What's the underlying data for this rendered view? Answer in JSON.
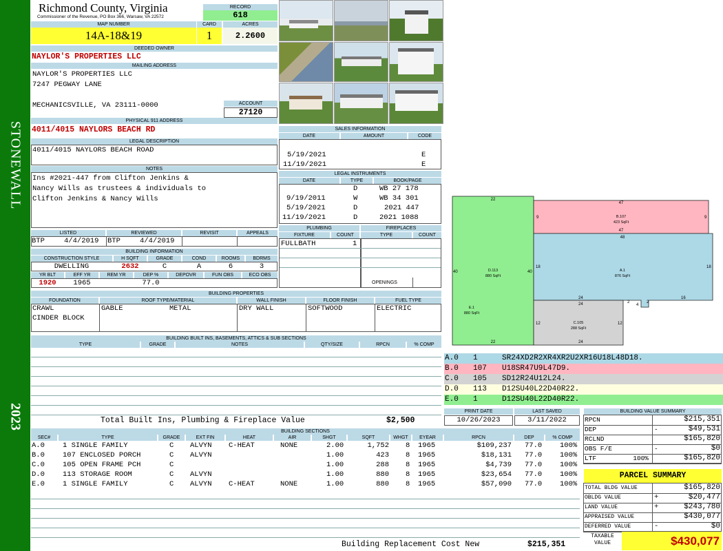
{
  "side": {
    "label": "STONEWALL",
    "year": "2023"
  },
  "header": {
    "county": "Richmond County, Virginia",
    "commissioner": "Commissioner of the Revenue, PO Box 366, Warsaw, VA 22572",
    "record_label": "RECORD",
    "record": "618",
    "map_label": "MAP NUMBER",
    "map": "14A-18&19",
    "card_label": "CARD",
    "card": "1",
    "acres_label": "ACRES",
    "acres": "2.2600"
  },
  "owner": {
    "label": "DEEDED OWNER",
    "name": "NAYLOR'S PROPERTIES LLC",
    "mail_label": "MAILING ADDRESS",
    "mail1": "NAYLOR'S PROPERTIES LLC",
    "mail2": "7247 PEGWAY LANE",
    "mail3": "MECHANICSVILLE, VA 23111-0000",
    "account_label": "ACCOUNT",
    "account": "27120",
    "phys_label": "PHYSICAL 911 ADDRESS",
    "phys": "4011/4015 NAYLORS BEACH RD",
    "legal_label": "LEGAL DESCRIPTION",
    "legal": "4011/4015 NAYLORS BEACH ROAD",
    "notes_label": "NOTES",
    "notes": [
      "Ins #2021-447 from Clifton Jenkins &",
      "Nancy Wills as trustees & individuals to",
      "Clifton Jenkins & Nancy Wills"
    ]
  },
  "review": {
    "listed_label": "LISTED",
    "reviewed_label": "REVIEWED",
    "revisit_label": "REVISIT",
    "appeals_label": "APPEALS",
    "listed_by": "BTP",
    "listed": "4/4/2019",
    "reviewed_by": "BTP",
    "reviewed": "4/4/2019"
  },
  "bldg_info": {
    "label": "BUILDING INFORMATION",
    "h": [
      "CONSTRUCTION STYLE",
      "H SQFT",
      "GRADE",
      "COND",
      "ROOMS",
      "BDRMS"
    ],
    "v": [
      "DWELLING",
      "2632",
      "C",
      "A",
      "6",
      "3"
    ],
    "h2": [
      "YR BLT",
      "EFF YR",
      "REM YR",
      "DEP %",
      "DEPOVR",
      "FUN OBS",
      "ECO OBS"
    ],
    "v2": [
      "1920",
      "1965",
      "",
      "77.0",
      "",
      "",
      ""
    ]
  },
  "props": {
    "label": "BUILDING PROPERTIES",
    "h": [
      "FOUNDATION",
      "ROOF TYPE/MATERIAL",
      "WALL FINISH",
      "FLOOR FINISH",
      "FUEL TYPE"
    ],
    "foundation": [
      "CRAWL",
      "CINDER BLOCK"
    ],
    "roof1": "GABLE",
    "roof2": "METAL",
    "wall": "DRY WALL",
    "floor": "SOFTWOOD",
    "fuel": "ELECTRIC"
  },
  "builtins": {
    "label": "BUILDING BUILT INS, BASEMENTS, ATTICS & SUB SECTIONS",
    "h": [
      "TYPE",
      "GRADE",
      "NOTES",
      "QTY/SIZE",
      "RPCN",
      "% COMP"
    ],
    "total_label": "Total Built Ins, Plumbing & Fireplace Value",
    "total": "$2,500"
  },
  "sales": {
    "label": "SALES INFORMATION",
    "h": [
      "DATE",
      "AMOUNT",
      "CODE"
    ],
    "rows": [
      [
        "5/19/2021",
        "",
        "E"
      ],
      [
        "11/19/2021",
        "",
        "E"
      ]
    ]
  },
  "instruments": {
    "label": "LEGAL INSTRUMENTS",
    "h": [
      "DATE",
      "TYPE",
      "BOOK/PAGE"
    ],
    "rows": [
      [
        "",
        "D",
        "WB 27 178"
      ],
      [
        "9/19/2011",
        "W",
        "WB 34 301"
      ],
      [
        "5/19/2021",
        "D",
        "2021 447"
      ],
      [
        "11/19/2021",
        "D",
        "2021 1088"
      ]
    ]
  },
  "plumbing": {
    "label": "PLUMBING",
    "h": [
      "FIXTURE",
      "COUNT"
    ],
    "rows": [
      [
        "FULLBATH",
        "1"
      ]
    ]
  },
  "fireplaces": {
    "label": "FIREPLACES",
    "h": [
      "TYPE",
      "COUNT"
    ],
    "openings": "OPENINGS"
  },
  "sketch": {
    "nums": [
      "22",
      "47",
      "9",
      "9",
      "48",
      "47",
      "40",
      "40",
      "18",
      "18",
      "24",
      "24",
      "2",
      "2",
      "4",
      "16",
      "12",
      "12",
      "22",
      "24"
    ],
    "areas": [
      {
        "id": "B.107",
        "area": "423 SqFt"
      },
      {
        "id": "D.113",
        "area": "880 SqFt"
      },
      {
        "id": "A.1",
        "area": "876 SqFt"
      },
      {
        "id": "E.1",
        "area": "880 SqFt"
      },
      {
        "id": "C.105",
        "area": "288 SqFt"
      }
    ]
  },
  "legend": [
    {
      "sec": "A.0",
      "code": "1",
      "vec": "SR24XD2R2XR4XR2U2XR16U18L48D18.",
      "color": "#add8e6"
    },
    {
      "sec": "B.0",
      "code": "107",
      "vec": "U18SR47U9L47D9.",
      "color": "#ffb6c1"
    },
    {
      "sec": "C.0",
      "code": "105",
      "vec": "SD12R24U12L24.",
      "color": "#d3d3d3"
    },
    {
      "sec": "D.0",
      "code": "113",
      "vec": "D12SU40L22D40R22.",
      "color": "#ffffe0"
    },
    {
      "sec": "E.0",
      "code": "1",
      "vec": "D12SU40L22D40R22.",
      "color": "#90ee90"
    }
  ],
  "dates": {
    "print_label": "PRINT DATE",
    "saved_label": "LAST SAVED",
    "print": "10/26/2023",
    "saved": "3/11/2022"
  },
  "sections": {
    "label": "BUILDING SECTIONS",
    "h": [
      "SEC#",
      "TYPE",
      "GRADE",
      "EXT FIN",
      "HEAT",
      "AIR",
      "SHGT",
      "SQFT",
      "WHGT",
      "EYEAR",
      "RPCN",
      "DEP",
      "% COMP"
    ],
    "rows": [
      [
        "A.0",
        "1 SINGLE FAMILY",
        "C",
        "ALVYN",
        "C-HEAT",
        "NONE",
        "2.00",
        "1,752",
        "8",
        "1965",
        "$109,237",
        "77.0",
        "100%"
      ],
      [
        "B.0",
        "107 ENCLOSED PORCH",
        "C",
        "ALVYN",
        "",
        "",
        "1.00",
        "423",
        "8",
        "1965",
        "$18,131",
        "77.0",
        "100%"
      ],
      [
        "C.0",
        "105 OPEN FRAME PCH",
        "C",
        "",
        "",
        "",
        "1.00",
        "288",
        "8",
        "1965",
        "$4,739",
        "77.0",
        "100%"
      ],
      [
        "D.0",
        "113 STORAGE ROOM",
        "C",
        "ALVYN",
        "",
        "",
        "1.00",
        "880",
        "8",
        "1965",
        "$23,654",
        "77.0",
        "100%"
      ],
      [
        "E.0",
        "1 SINGLE FAMILY",
        "C",
        "ALVYN",
        "C-HEAT",
        "NONE",
        "1.00",
        "880",
        "8",
        "1965",
        "$57,090",
        "77.0",
        "100%"
      ]
    ],
    "replacement_label": "Building Replacement Cost New",
    "replacement": "$215,351"
  },
  "bvs": {
    "label": "BUILDING VALUE SUMMARY",
    "rows": [
      [
        "RPCN",
        "",
        "$215,351"
      ],
      [
        "DEP",
        "-",
        "$49,531"
      ],
      [
        "RCLND",
        "",
        "$165,820"
      ],
      [
        "OBS F/E",
        "-",
        "$0"
      ],
      [
        "LTF",
        "100%",
        "$165,820"
      ]
    ]
  },
  "parcel": {
    "label": "PARCEL SUMMARY",
    "rows": [
      [
        "TOTAL BLDG VALUE",
        "",
        "$165,820"
      ],
      [
        "OBLDG VALUE",
        "+",
        "$20,477"
      ],
      [
        "LAND VALUE",
        "+",
        "$243,780"
      ],
      [
        "APPRAISED VALUE",
        "",
        "$430,077"
      ],
      [
        "DEFERRED VALUE",
        "-",
        "$0"
      ]
    ],
    "taxable_label": "TAXABLE VALUE",
    "taxable": "$430,077"
  }
}
